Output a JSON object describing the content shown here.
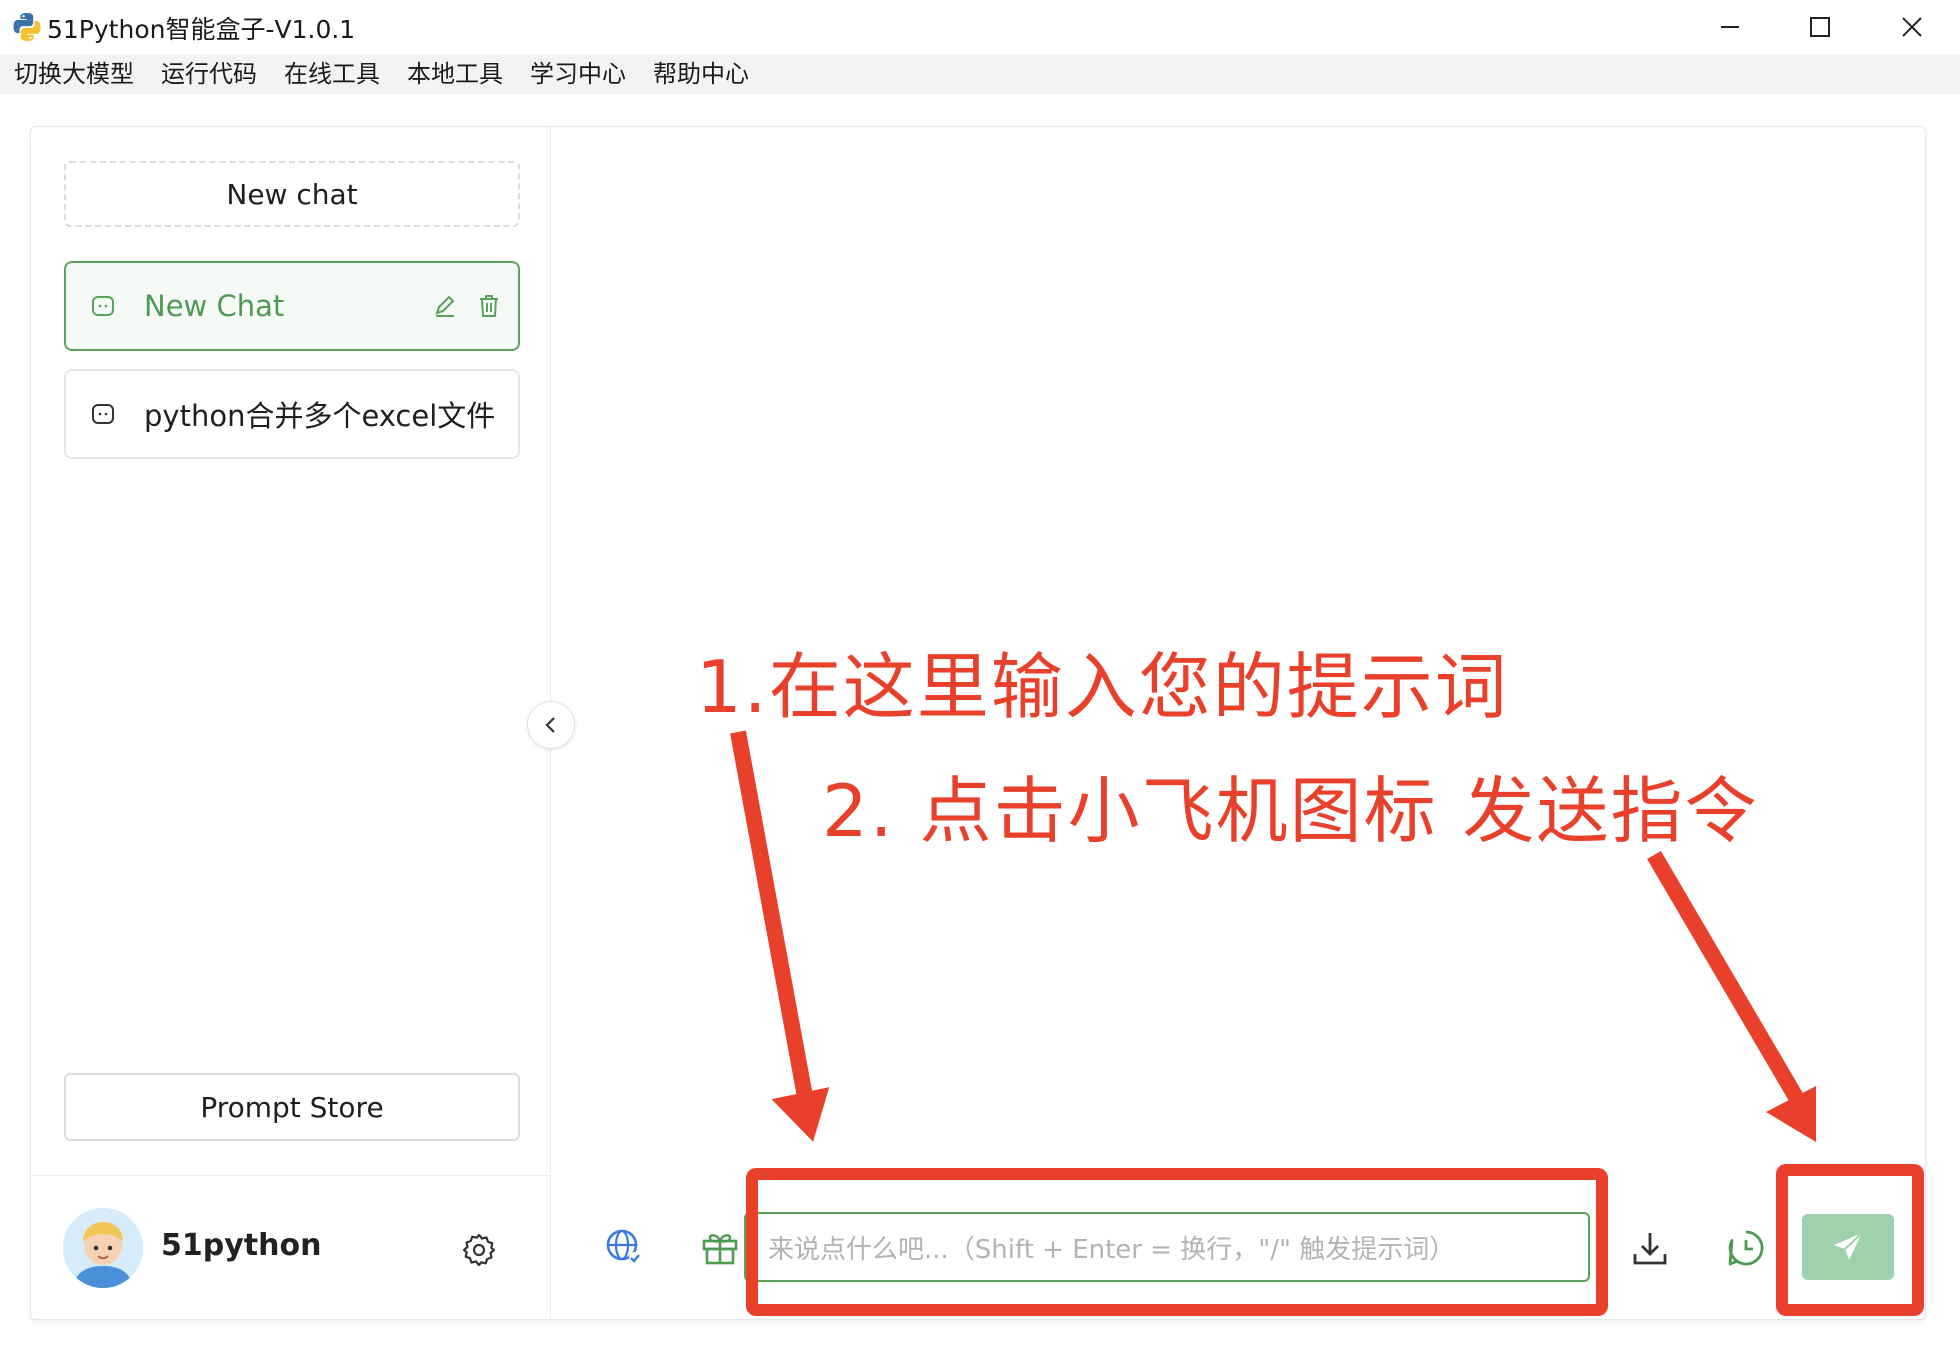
{
  "window": {
    "title": "51Python智能盒子-V1.0.1",
    "minimize_icon": "minimize-icon",
    "maximize_icon": "maximize-icon",
    "close_icon": "close-icon"
  },
  "menu": {
    "items": [
      "切换大模型",
      "运行代码",
      "在线工具",
      "本地工具",
      "学习中心",
      "帮助中心"
    ]
  },
  "sidebar": {
    "new_chat_label": "New chat",
    "chats": [
      {
        "label": "New Chat",
        "active": true
      },
      {
        "label": "python合并多个excel文件",
        "active": false
      }
    ],
    "prompt_store_label": "Prompt Store",
    "user": {
      "name": "51python"
    }
  },
  "composer": {
    "placeholder": "来说点什么吧...（Shift + Enter = 换行，\"/\" 触发提示词）"
  },
  "annotations": {
    "step1": "1.在这里输入您的提示词",
    "step2": "2. 点击小飞机图标 发送指令"
  },
  "colors": {
    "accent_green": "#5aa15c",
    "send_button": "#9fd1ad",
    "annotation_red": "#e8402a"
  }
}
